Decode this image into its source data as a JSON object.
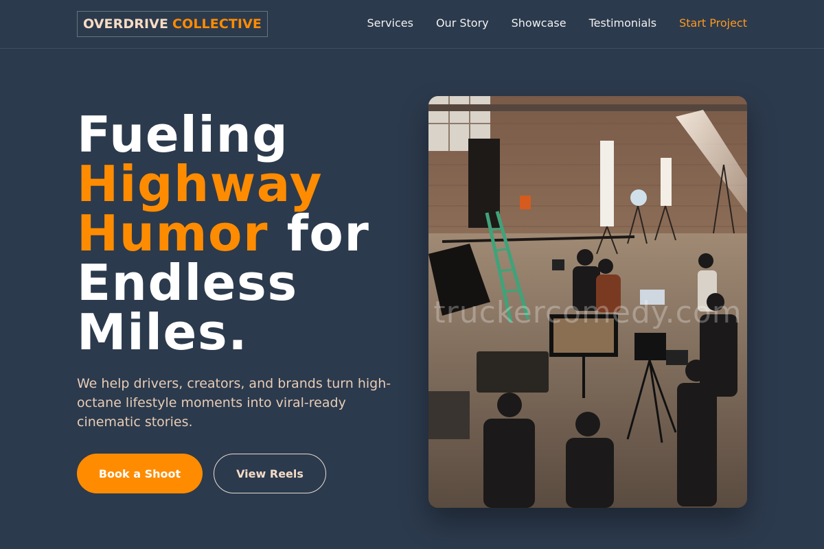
{
  "brand": {
    "name_part1": "OVERDRIVE",
    "name_part2": "COLLECTIVE"
  },
  "nav": {
    "links": [
      "Services",
      "Our Story",
      "Showcase",
      "Testimonials"
    ],
    "cta": "Start Project"
  },
  "hero": {
    "title": {
      "line1": "Fueling",
      "line2_accent": "Highway",
      "line3_accent": "Humor",
      "line3_rest": "for",
      "line4": "Endless",
      "line5": "Miles."
    },
    "subtitle": "We help drivers, creators, and brands turn high-octane lifestyle moments into viral-ready cinematic stories.",
    "primary_button": "Book a Shoot",
    "secondary_button": "View Reels",
    "image_watermark": "truckercomedy.com"
  },
  "colors": {
    "background": "#2c3a4d",
    "accent": "#ff8c00",
    "text_light": "#ffffff",
    "text_warm": "#e8cdb6"
  }
}
